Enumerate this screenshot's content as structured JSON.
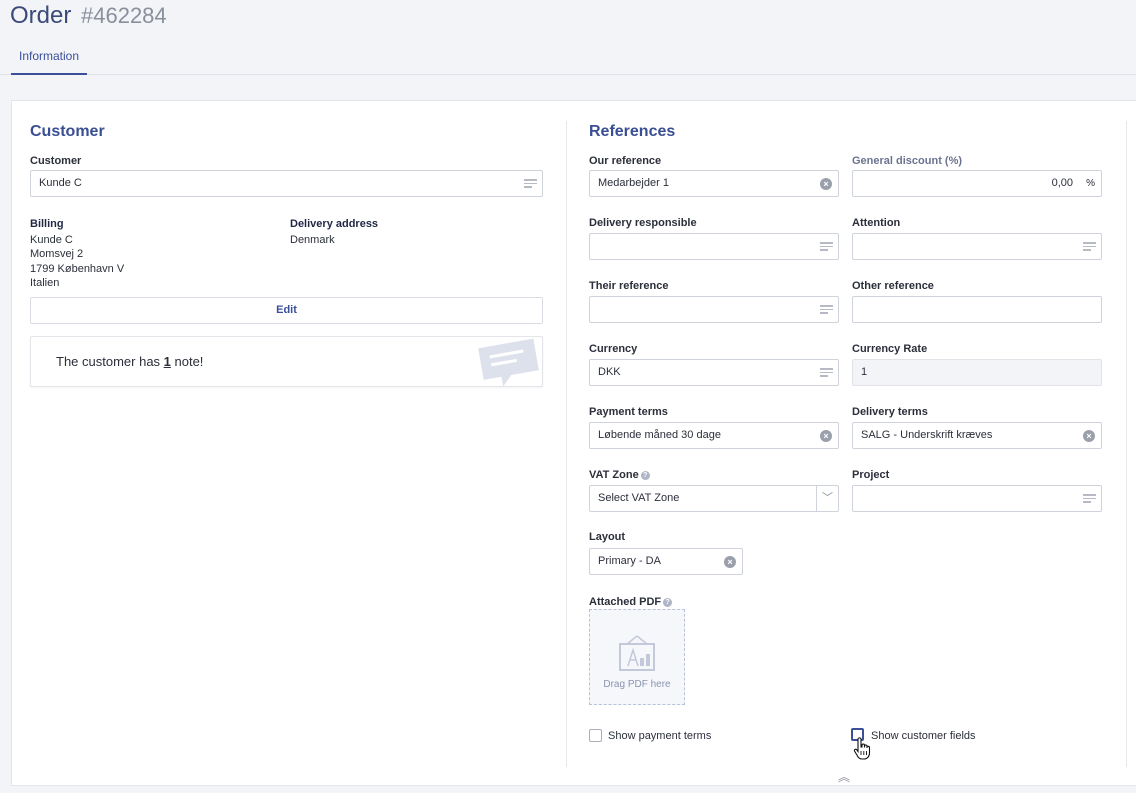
{
  "header": {
    "title": "Order",
    "order_number": "#462284",
    "tabs": [
      {
        "label": "Information"
      }
    ]
  },
  "customer_section": {
    "heading": "Customer",
    "customer_label": "Customer",
    "customer_value": "Kunde C",
    "billing": {
      "label": "Billing",
      "lines": [
        "Kunde C",
        "Momsvej 2",
        "1799 København V",
        "Italien"
      ]
    },
    "delivery": {
      "label": "Delivery address",
      "lines": [
        "Denmark"
      ]
    },
    "edit_label": "Edit",
    "note": {
      "prefix": "The customer has ",
      "count": "1",
      "suffix": " note!"
    }
  },
  "references": {
    "heading": "References",
    "our_reference": {
      "label": "Our reference",
      "value": "Medarbejder 1"
    },
    "general_discount": {
      "label": "General discount (%)",
      "value": "0,00",
      "unit": "%"
    },
    "delivery_responsible": {
      "label": "Delivery responsible",
      "value": ""
    },
    "attention": {
      "label": "Attention",
      "value": ""
    },
    "their_reference": {
      "label": "Their reference",
      "value": ""
    },
    "other_reference": {
      "label": "Other reference",
      "value": ""
    },
    "currency": {
      "label": "Currency",
      "value": "DKK"
    },
    "currency_rate": {
      "label": "Currency Rate",
      "value": "1"
    },
    "payment_terms": {
      "label": "Payment terms",
      "value": "Løbende måned 30 dage"
    },
    "delivery_terms": {
      "label": "Delivery terms",
      "value": "SALG - Underskrift kræves"
    },
    "vat_zone": {
      "label": "VAT Zone",
      "value": "Select VAT Zone"
    },
    "project": {
      "label": "Project",
      "value": ""
    },
    "layout": {
      "label": "Layout",
      "value": "Primary - DA"
    },
    "attached_pdf": {
      "label": "Attached PDF",
      "drop_text": "Drag PDF here"
    },
    "show_payment_terms": {
      "label": "Show payment terms",
      "checked": false
    },
    "show_customer_fields": {
      "label": "Show customer fields",
      "checked": false
    }
  },
  "icons": {
    "help": "?",
    "clear": "×",
    "chevron_down": "﹀",
    "collapse": "︽"
  },
  "colors": {
    "accent": "#3b4f9a",
    "heading": "#3a4f93",
    "muted": "#8a8f9c"
  }
}
